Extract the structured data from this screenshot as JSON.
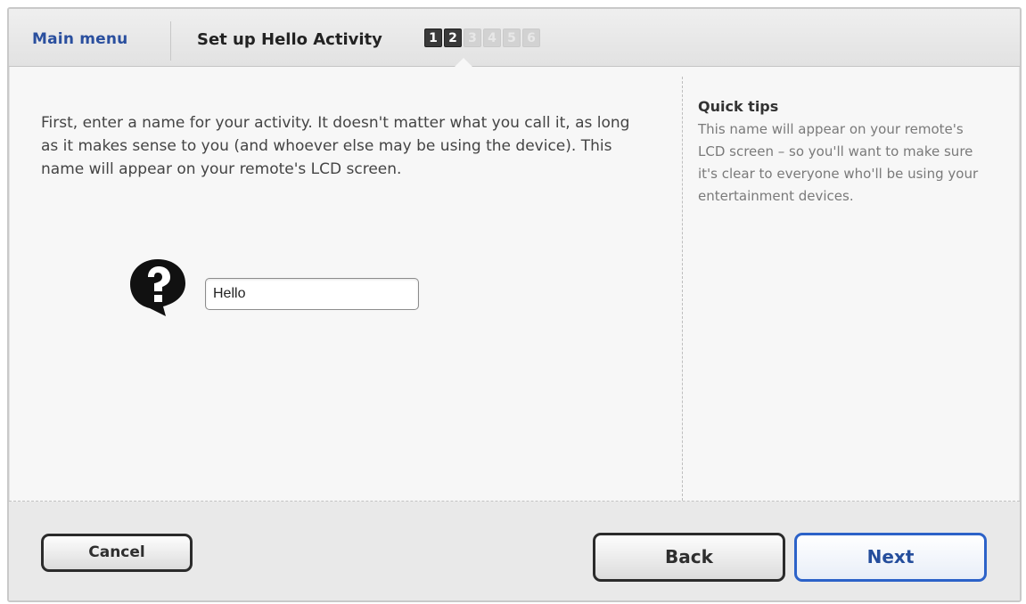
{
  "header": {
    "main_menu_label": "Main menu",
    "title": "Set up Hello Activity",
    "steps": [
      {
        "label": "1",
        "state": "done"
      },
      {
        "label": "2",
        "state": "done"
      },
      {
        "label": "3",
        "state": "todo"
      },
      {
        "label": "4",
        "state": "todo"
      },
      {
        "label": "5",
        "state": "todo"
      },
      {
        "label": "6",
        "state": "todo"
      }
    ],
    "current_step": 2
  },
  "main": {
    "intro": "First, enter a name for your activity. It doesn't matter what you call it, as long as it makes sense to you (and whoever else may be using the device). This name will appear on your remote's LCD screen.",
    "icon": "question-speech-bubble-icon",
    "name_input_value": "Hello"
  },
  "tips": {
    "title": "Quick tips",
    "body": "This name will appear on your remote's LCD screen – so you'll want to make sure it's clear to everyone who'll be using your entertainment devices."
  },
  "footer": {
    "cancel_label": "Cancel",
    "back_label": "Back",
    "next_label": "Next"
  },
  "colors": {
    "link": "#2a4f9e",
    "next_border": "#2c62c8",
    "button_border": "#2b2b2b"
  }
}
